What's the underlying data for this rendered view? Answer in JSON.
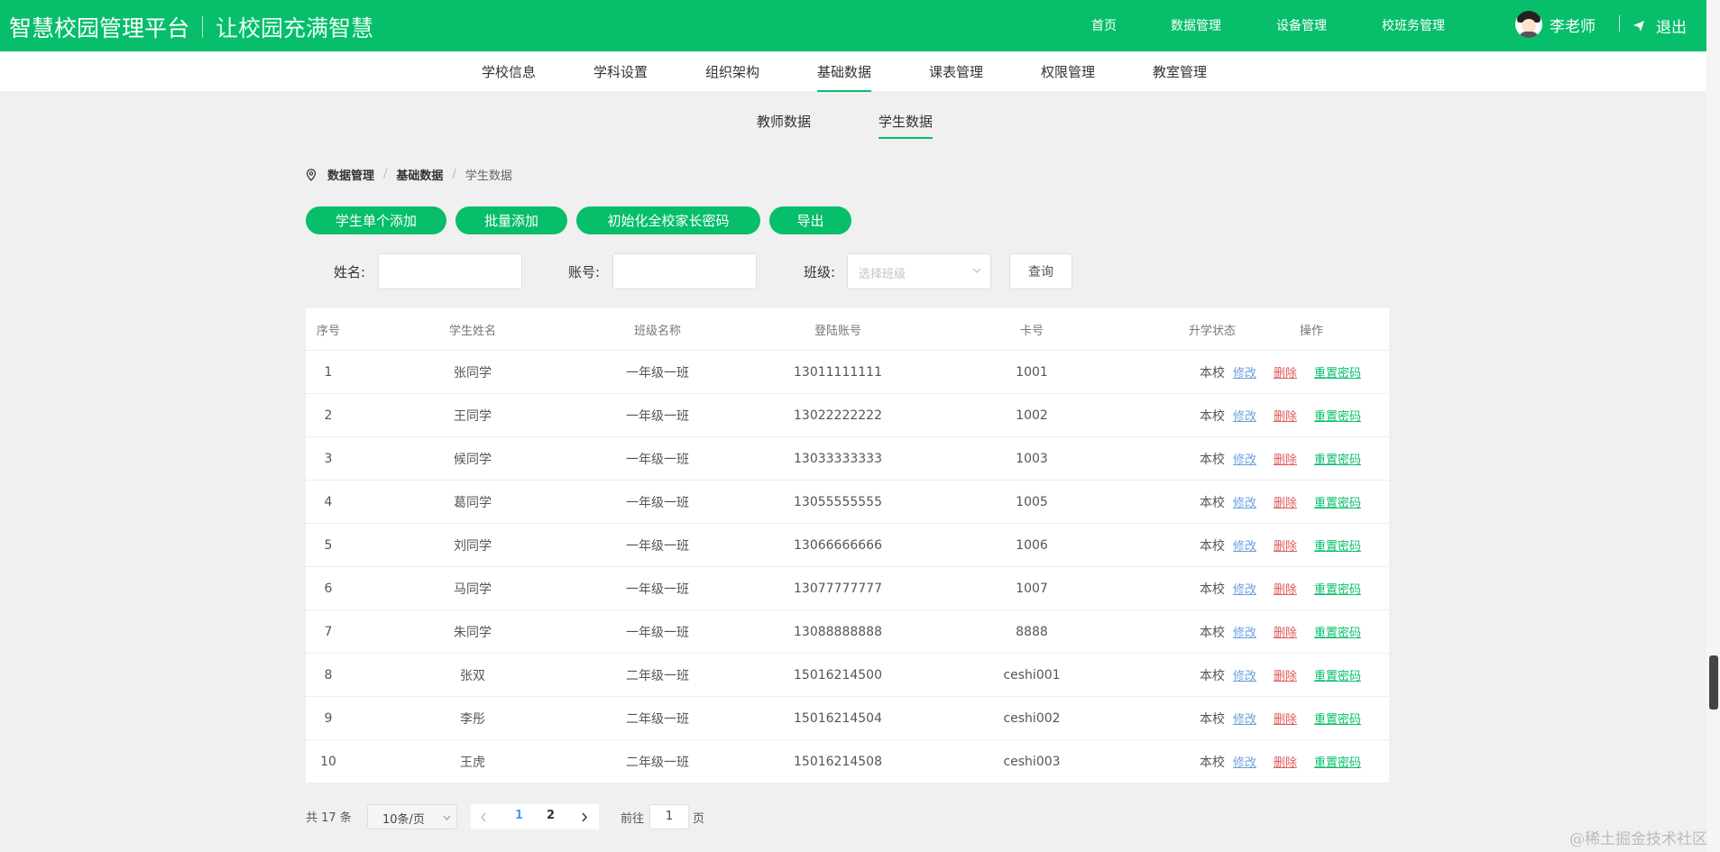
{
  "header": {
    "brand_title": "智慧校园管理平台",
    "brand_slogan": "让校园充满智慧",
    "nav": [
      "首页",
      "数据管理",
      "设备管理",
      "校班务管理"
    ],
    "user_name": "李老师",
    "logout_label": "退出",
    "color_primary": "#07be6b"
  },
  "subnav": {
    "items": [
      "学校信息",
      "学科设置",
      "组织架构",
      "基础数据",
      "课表管理",
      "权限管理",
      "教室管理"
    ],
    "active": "基础数据"
  },
  "tabs": {
    "items": [
      "教师数据",
      "学生数据"
    ],
    "active": "学生数据"
  },
  "breadcrumb": [
    "数据管理",
    "基础数据",
    "学生数据"
  ],
  "actions": [
    "学生单个添加",
    "批量添加",
    "初始化全校家长密码",
    "导出"
  ],
  "filter": {
    "name_label": "姓名:",
    "name_value": "",
    "account_label": "账号:",
    "account_value": "",
    "class_label": "班级:",
    "class_placeholder": "选择班级",
    "query_label": "查询"
  },
  "table": {
    "columns": [
      "序号",
      "学生姓名",
      "班级名称",
      "登陆账号",
      "卡号",
      "升学状态",
      "操作"
    ],
    "rows": [
      [
        "1",
        "张同学",
        "一年级一班",
        "13011111111",
        "1001",
        "本校"
      ],
      [
        "2",
        "王同学",
        "一年级一班",
        "13022222222",
        "1002",
        "本校"
      ],
      [
        "3",
        "候同学",
        "一年级一班",
        "13033333333",
        "1003",
        "本校"
      ],
      [
        "4",
        "葛同学",
        "一年级一班",
        "13055555555",
        "1005",
        "本校"
      ],
      [
        "5",
        "刘同学",
        "一年级一班",
        "13066666666",
        "1006",
        "本校"
      ],
      [
        "6",
        "马同学",
        "一年级一班",
        "13077777777",
        "1007",
        "本校"
      ],
      [
        "7",
        "朱同学",
        "一年级一班",
        "13088888888",
        "8888",
        "本校"
      ],
      [
        "8",
        "张双",
        "二年级一班",
        "15016214500",
        "ceshi001",
        "本校"
      ],
      [
        "9",
        "李彤",
        "二年级一班",
        "15016214504",
        "ceshi002",
        "本校"
      ],
      [
        "10",
        "王虎",
        "二年级一班",
        "15016214508",
        "ceshi003",
        "本校"
      ]
    ],
    "op_edit": "修改",
    "op_delete": "删除",
    "op_reset": "重置密码"
  },
  "pagination": {
    "total_text": "共 17 条",
    "page_size": "10条/页",
    "pages": [
      "1",
      "2"
    ],
    "current_page": "1",
    "goto_prefix": "前往",
    "goto_value": "1",
    "goto_suffix": "页"
  },
  "watermark": "@稀土掘金技术社区"
}
